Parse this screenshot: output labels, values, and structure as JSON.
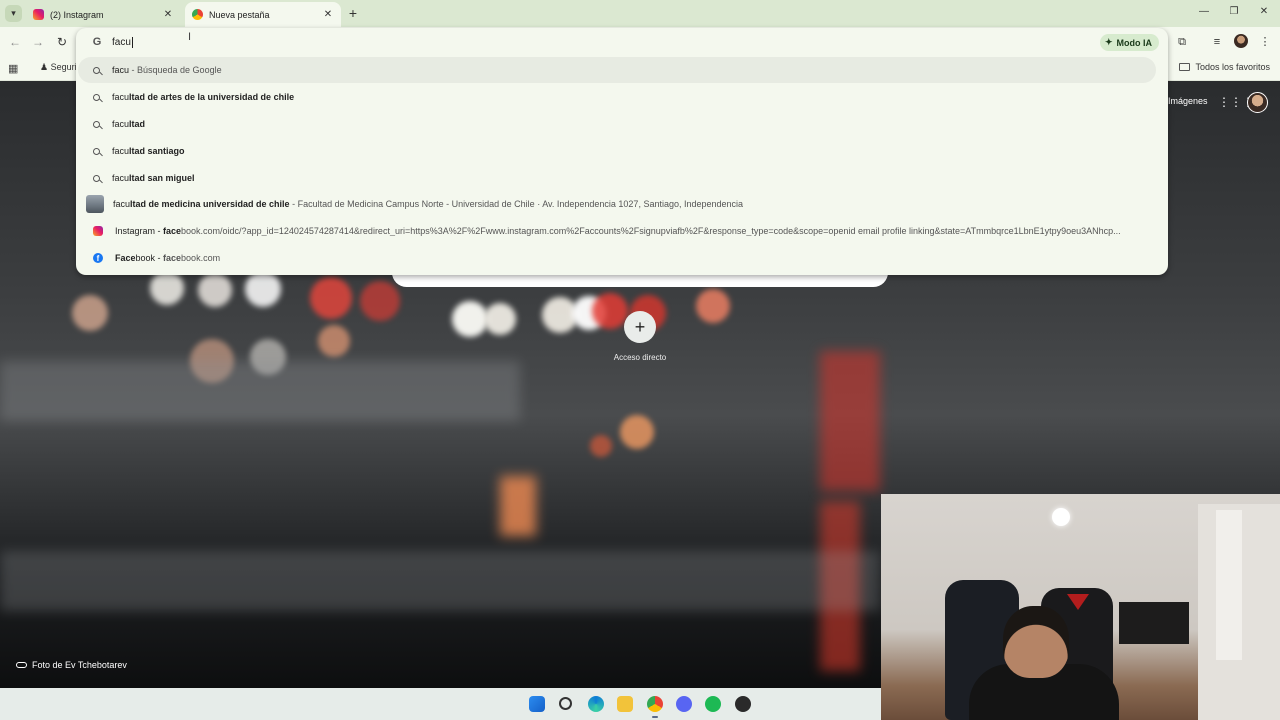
{
  "tabs": [
    {
      "title": "(2) Instagram",
      "active": false,
      "favicon": "instagram-icon"
    },
    {
      "title": "Nueva pestaña",
      "active": true,
      "favicon": "chrome-icon"
    }
  ],
  "omnibox": {
    "value": "facu",
    "modo_ia_label": "Modo IA"
  },
  "bookmarks": {
    "first_item": "Seguri",
    "all_bookmarks_label": "Todos los favoritos"
  },
  "suggestions": [
    {
      "icon": "search-icon",
      "prefix": "facu",
      "bold": "",
      "suffix": " - Búsqueda de Google"
    },
    {
      "icon": "search-icon",
      "prefix": "facu",
      "bold": "ltad de artes de la universidad de chile",
      "suffix": ""
    },
    {
      "icon": "search-icon",
      "prefix": "facu",
      "bold": "ltad",
      "suffix": ""
    },
    {
      "icon": "search-icon",
      "prefix": "facu",
      "bold": "ltad santiago",
      "suffix": ""
    },
    {
      "icon": "search-icon",
      "prefix": "facu",
      "bold": "ltad san miguel",
      "suffix": ""
    },
    {
      "icon": "place-thumbnail",
      "prefix": "facu",
      "bold": "ltad de medicina universidad de chile",
      "suffix": " - Facultad de Medicina Campus Norte - Universidad de Chile · Av. Independencia 1027, Santiago, Independencia"
    },
    {
      "icon": "instagram-icon",
      "prefix": "Instagram - ",
      "bold": "face",
      "suffix": "book.com/oidc/?app_id=124024574287414&redirect_uri=https%3A%2F%2Fwww.instagram.com%2Faccounts%2Fsignupviafb%2F&response_type=code&scope=openid email profile linking&state=ATmmbqrce1LbnE1ytpy9oeu3ANhcp..."
    },
    {
      "icon": "facebook-icon",
      "prefix": "",
      "bold": "Face",
      "suffix": "book - "
    }
  ],
  "facebook_url": {
    "bold": "face",
    "rest": "book.com"
  },
  "page": {
    "imagenes_label": "Imágenes",
    "shortcut_label": "Acceso directo",
    "photo_credit": "Foto de Ev Tchebotarev"
  },
  "colors": {
    "chrome_green": "#dbe8d1",
    "toolbar_bg": "#f4f8ee",
    "highlight": "#e7ebe2",
    "modo_ia_bg": "#d7ebce"
  }
}
